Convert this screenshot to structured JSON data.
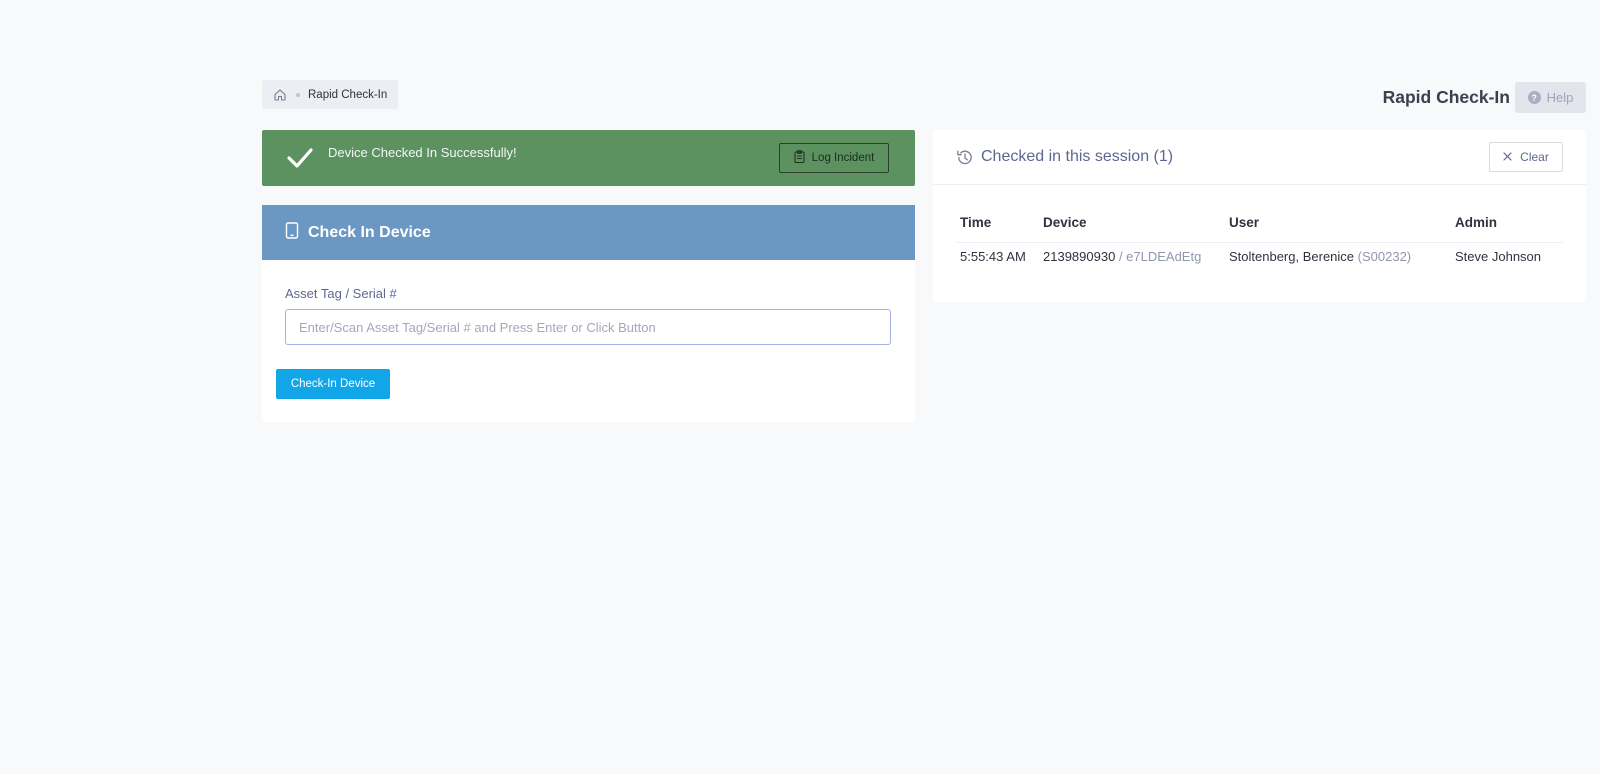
{
  "breadcrumb": {
    "home_icon": "home-icon",
    "current": "Rapid Check-In"
  },
  "page": {
    "title": "Rapid Check-In",
    "help_label": "Help"
  },
  "alert": {
    "message": "Device Checked In Successfully!",
    "log_incident_label": "Log Incident",
    "color": "#5c9260"
  },
  "checkin": {
    "header": "Check In Device",
    "field_label": "Asset Tag / Serial #",
    "placeholder": "Enter/Scan Asset Tag/Serial # and Press Enter or Click Button",
    "value": "",
    "button_label": "Check-In Device",
    "header_color": "#6b98c3",
    "button_color": "#11a6e8"
  },
  "session": {
    "title": "Checked in this session (1)",
    "clear_label": "Clear",
    "columns": [
      "Time",
      "Device",
      "User",
      "Admin"
    ],
    "rows": [
      {
        "time": "5:55:43 AM",
        "asset_tag": "2139890930",
        "serial": "/ e7LDEAdEtg",
        "user": "Stoltenberg, Berenice",
        "user_id": "(S00232)",
        "admin": "Steve Johnson"
      }
    ]
  }
}
